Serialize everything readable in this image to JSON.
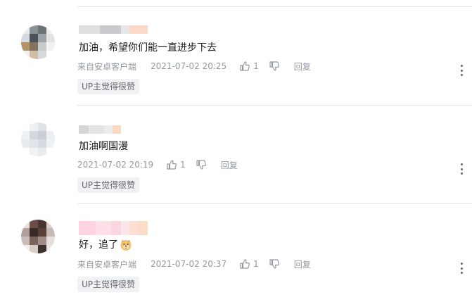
{
  "comments": [
    {
      "content": "加油，希望你们能一直进步下去",
      "source": "来自安卓客户端",
      "time": "2021-07-02 20:25",
      "likes": "1",
      "reply_label": "回复",
      "badge": "UP主觉得很赞"
    },
    {
      "content": "加油啊国漫",
      "source": "",
      "time": "2021-07-02 20:19",
      "likes": "1",
      "reply_label": "回复",
      "badge": "UP主觉得很赞"
    },
    {
      "content": "好，追了",
      "emoji": "doge-emoji",
      "source": "来自安卓客户端",
      "time": "2021-07-02 20:37",
      "likes": "1",
      "reply_label": "回复",
      "badge": "UP主觉得很赞"
    }
  ],
  "colors": {
    "meta_text": "#9499a0",
    "divider": "#e3e5e7",
    "badge_bg": "#f1f2f3"
  }
}
